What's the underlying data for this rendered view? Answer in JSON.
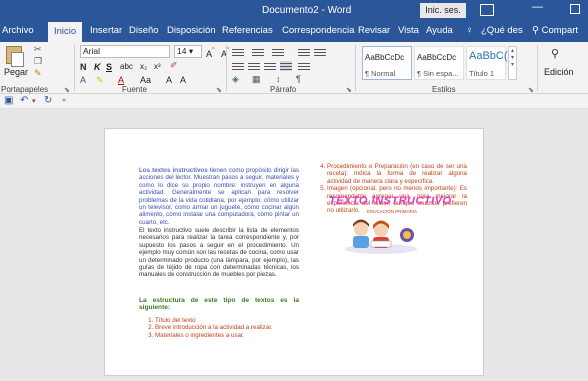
{
  "window": {
    "title": "Documento2 - Word",
    "signin": "Inic. ses."
  },
  "tabs": [
    "Archivo",
    "Inicio",
    "Insertar",
    "Diseño",
    "Disposición",
    "Referencias",
    "Correspondencia",
    "Revisar",
    "Vista",
    "Ayuda",
    "¿Qué des",
    "Compart"
  ],
  "ribbon": {
    "clipboard": {
      "label": "Portapapeles",
      "paste": "Pegar"
    },
    "font": {
      "label": "Fuente",
      "name": "Arial",
      "size": "14"
    },
    "paragraph": {
      "label": "Párrafo"
    },
    "styles": {
      "label": "Estilos",
      "items": [
        {
          "sample": "AaBbCcDc",
          "name": "¶ Normal"
        },
        {
          "sample": "AaBbCcDc",
          "name": "¶ Sin espa..."
        },
        {
          "sample": "AaBbC(",
          "name": "Título 1"
        }
      ]
    },
    "editing": {
      "label": "Edición"
    }
  },
  "document": {
    "left": {
      "p1_highlight": "Los textos instructivos",
      "p1": "tienen como propósito dirigir las acciones del lector. Muestran pasos a seguir, materiales y como lo dice su propio nombre: instruyen en alguna actividad. Generalmente se aplican para resolver problemas de la vida cotidiana, por ejemplo: cómo utilizar un televisor, como armar un juguete, cómo cocinar algún alimento, cómo instalar una computadora, cómo pintar un cuarto, etc.",
      "p2": "El texto instructivo suele describir la lista de elementos necesarios para realizar la tarea correspondiente y, por supuesto los pasos a seguir en el procedimiento. Un ejemplo muy común son las recetas de cocina, como usar un determinado producto (una lámpara, por ejemplo), las guías de tejido de ropa con determinadas técnicas, los manuales de construcción de muebles por piezas.",
      "heading": "La estructura de este tipo de textos es la siguiente:",
      "list": [
        "Título del texto",
        "Breve introducción a la actividad a realizar.",
        "Materiales o ingredientes a usar."
      ]
    },
    "right": {
      "list": [
        "Procedimiento o Preparación (en caso de ser una receta): Indica la forma de realizar alguna actividad de manera clara y específica.",
        "Imagen (opcional, pero no menos importante): Es recomendable agregar una, para mejorar la experiencia del lector, aunque muchos prefieren no utilizarlo."
      ],
      "illustration_title": "TEXTO INSTRUCTIVO",
      "illustration_subtitle": "EDUCACIÓN PRIMARIA"
    }
  },
  "colors": {
    "accent": "#2b579a",
    "text_blue": "#3a4fb4",
    "text_green": "#3d7a26",
    "text_orange": "#c0441a",
    "illustration_pink": "#e33cc1"
  }
}
